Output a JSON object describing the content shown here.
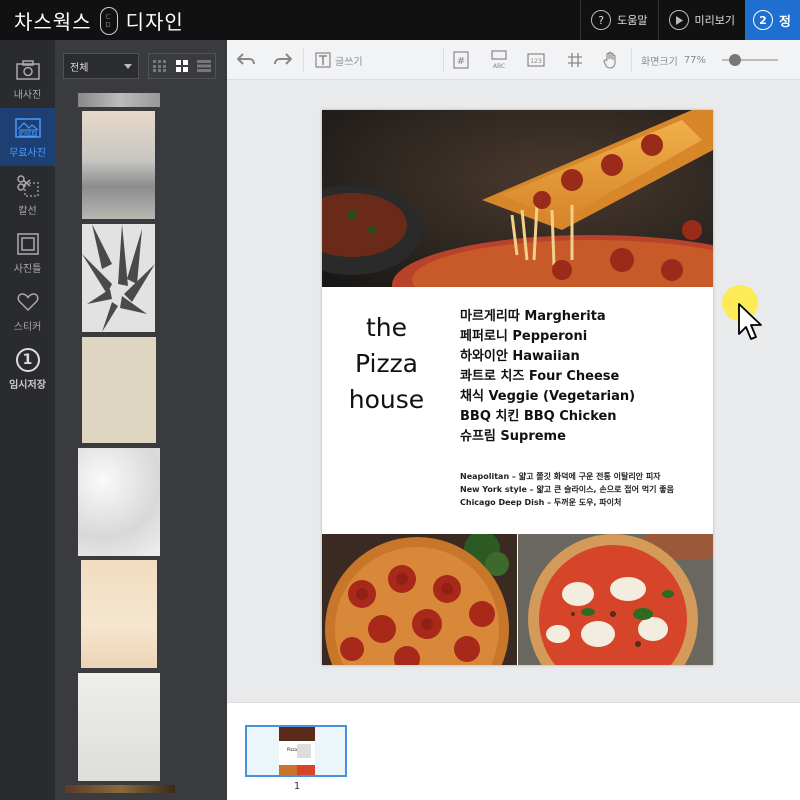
{
  "app": {
    "brand_left": "차스웍스",
    "brand_mark_top": "C",
    "brand_mark_bottom": "D",
    "brand_right": "디자인"
  },
  "top_actions": {
    "help": "도움말",
    "preview": "미리보기",
    "step_number": "2",
    "step_label": "정"
  },
  "sidebar": {
    "items": [
      {
        "label": "내사진",
        "icon": "camera-icon"
      },
      {
        "label": "무료사진",
        "icon": "free-photo-icon"
      },
      {
        "label": "칼선",
        "icon": "scissors-icon"
      },
      {
        "label": "사진틀",
        "icon": "frame-icon"
      },
      {
        "label": "스티커",
        "icon": "heart-icon"
      },
      {
        "label": "임시저장",
        "icon": "save-temp-icon",
        "badge": "1"
      }
    ]
  },
  "panel": {
    "filter_value": "전체"
  },
  "toolbar": {
    "text_label": "글쓰기",
    "zoom_label": "화면크기",
    "zoom_value": "77%",
    "zoom_fraction": 0.77
  },
  "design": {
    "title_lines": [
      "the",
      "Pizza",
      "house"
    ],
    "menu": [
      "마르게리따 Margherita",
      "페퍼로니 Pepperoni",
      "하와이안 Hawaiian",
      "콰트로 치즈 Four Cheese",
      "채식 Veggie (Vegetarian)",
      "BBQ 치킨 BBQ Chicken",
      "슈프림 Supreme"
    ],
    "styles": [
      "Neapolitan – 얇고 쫄깃 화덕에 구운 전통 이탈리안 피자",
      "New York style – 얇고 큰 슬라이스, 손으로 접어 먹기 좋음",
      "Chicago Deep Dish – 두꺼운 도우, 파이처"
    ]
  },
  "pages": {
    "current": "1"
  }
}
